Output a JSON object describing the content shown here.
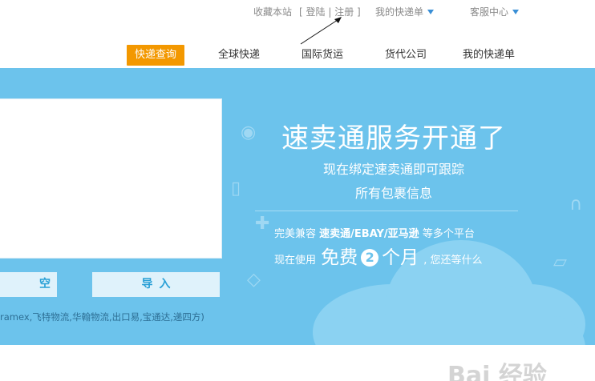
{
  "toplinks": {
    "favorite": "收藏本站",
    "login": "登陆",
    "register": "注册",
    "my_orders": "我的快递单",
    "service": "客服中心"
  },
  "nav": {
    "items": [
      {
        "label": "快递查询",
        "active": true
      },
      {
        "label": "全球快递"
      },
      {
        "label": "国际货运"
      },
      {
        "label": "货代公司"
      },
      {
        "label": "我的快递单"
      }
    ]
  },
  "banner": {
    "bg_color": "#6cc3ec",
    "clear_button": "空",
    "import_button": "导入",
    "carriers": "ramex,飞特物流,华翰物流,出口易,宝通达,递四方)",
    "headline": "速卖通服务开通了",
    "sub1": "现在绑定速卖通即可跟踪",
    "sub2": "所有包裹信息",
    "compat_prefix": "完美兼容",
    "compat_platforms": "速卖通/EBAY/亚马逊",
    "compat_suffix": "等多个平台",
    "free_prefix": "现在使用",
    "free_word": "免费",
    "free_num": "2",
    "free_unit": "个月",
    "free_suffix": ", 您还等什么"
  },
  "watermark": "Bai 经验",
  "colors": {
    "accent": "#f39800",
    "link_triangle": "#3a8fd6"
  }
}
